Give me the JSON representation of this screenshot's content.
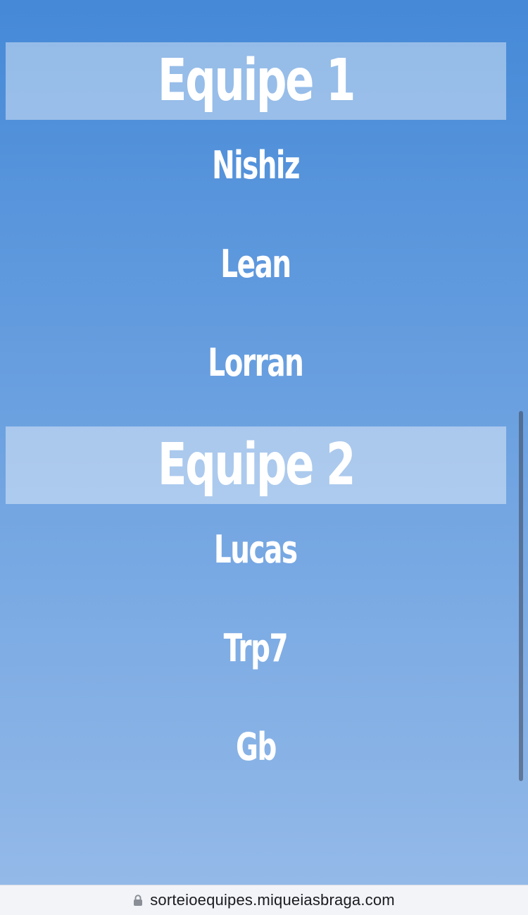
{
  "teams": [
    {
      "title": "Equipe 1",
      "players": [
        "Nishiz",
        "Lean",
        "Lorran"
      ]
    },
    {
      "title": "Equipe 2",
      "players": [
        "Lucas",
        "Trp7",
        "Gb"
      ]
    }
  ],
  "browser": {
    "url": "sorteioequipes.miqueiasbraga.com",
    "lock_icon": "lock-icon"
  },
  "colors": {
    "background_top": "#4589d7",
    "background_bottom": "#93b9e8",
    "text": "#ffffff"
  }
}
